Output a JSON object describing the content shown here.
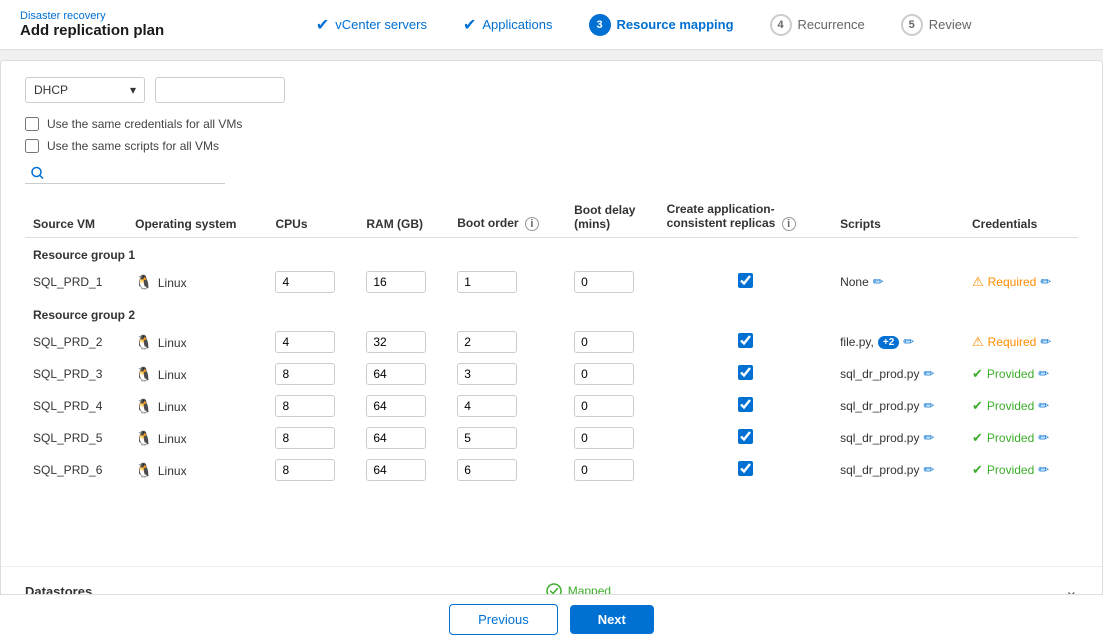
{
  "brand": {
    "sub_label": "Disaster recovery",
    "title": "Add replication plan"
  },
  "steps": [
    {
      "id": 1,
      "label": "vCenter servers",
      "state": "completed"
    },
    {
      "id": 2,
      "label": "Applications",
      "state": "completed"
    },
    {
      "id": 3,
      "label": "Resource mapping",
      "state": "active"
    },
    {
      "id": 4,
      "label": "Recurrence",
      "state": "upcoming"
    },
    {
      "id": 5,
      "label": "Review",
      "state": "upcoming"
    }
  ],
  "form": {
    "dhcp_value": "DHCP",
    "checkbox1": "Use the same credentials for all VMs",
    "checkbox2": "Use the same scripts for all VMs",
    "search_placeholder": "Search"
  },
  "table": {
    "columns": [
      "Source VM",
      "Operating system",
      "CPUs",
      "RAM (GB)",
      "Boot order",
      "Boot delay (mins)",
      "Create application-consistent replicas",
      "Scripts",
      "Credentials"
    ],
    "groups": [
      {
        "name": "Resource group 1",
        "rows": [
          {
            "vm": "SQL_PRD_1",
            "os": "Linux",
            "cpus": "4",
            "ram": "16",
            "boot_order": "1",
            "boot_delay": "0",
            "app_consistent": true,
            "scripts": "None",
            "scripts_extra": null,
            "cred_status": "Required"
          }
        ]
      },
      {
        "name": "Resource group 2",
        "rows": [
          {
            "vm": "SQL_PRD_2",
            "os": "Linux",
            "cpus": "4",
            "ram": "32",
            "boot_order": "2",
            "boot_delay": "0",
            "app_consistent": true,
            "scripts": "file.py,",
            "scripts_extra": "+2",
            "cred_status": "Required"
          },
          {
            "vm": "SQL_PRD_3",
            "os": "Linux",
            "cpus": "8",
            "ram": "64",
            "boot_order": "3",
            "boot_delay": "0",
            "app_consistent": true,
            "scripts": "sql_dr_prod.py",
            "scripts_extra": null,
            "cred_status": "Provided"
          },
          {
            "vm": "SQL_PRD_4",
            "os": "Linux",
            "cpus": "8",
            "ram": "64",
            "boot_order": "4",
            "boot_delay": "0",
            "app_consistent": true,
            "scripts": "sql_dr_prod.py",
            "scripts_extra": null,
            "cred_status": "Provided"
          },
          {
            "vm": "SQL_PRD_5",
            "os": "Linux",
            "cpus": "8",
            "ram": "64",
            "boot_order": "5",
            "boot_delay": "0",
            "app_consistent": true,
            "scripts": "sql_dr_prod.py",
            "scripts_extra": null,
            "cred_status": "Provided"
          },
          {
            "vm": "SQL_PRD_6",
            "os": "Linux",
            "cpus": "8",
            "ram": "64",
            "boot_order": "6",
            "boot_delay": "0",
            "app_consistent": true,
            "scripts": "sql_dr_prod.py",
            "scripts_extra": null,
            "cred_status": "Provided"
          }
        ]
      }
    ]
  },
  "datastores": {
    "label": "Datastores",
    "status": "Mapped"
  },
  "buttons": {
    "previous": "Previous",
    "next": "Next"
  }
}
